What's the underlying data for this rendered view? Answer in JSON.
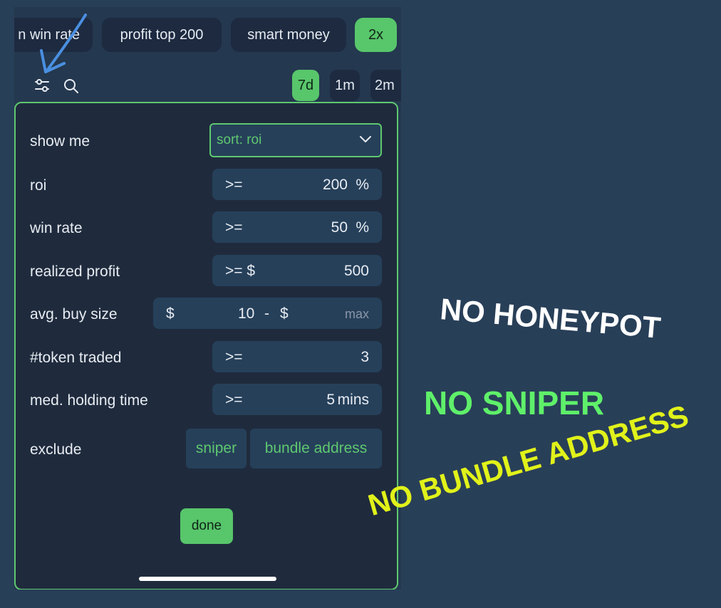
{
  "filter_pills": [
    {
      "label": "n win rate",
      "active": false
    },
    {
      "label": "profit top 200",
      "active": false
    },
    {
      "label": "smart money",
      "active": false
    },
    {
      "label": "2x",
      "active": true
    }
  ],
  "toolbar": {
    "filter_icon": "sliders-icon",
    "search_icon": "search-icon",
    "timeframes": [
      {
        "label": "7d",
        "active": true
      },
      {
        "label": "1m",
        "active": false
      },
      {
        "label": "2m",
        "active": false
      }
    ]
  },
  "filter_sheet": {
    "show_me": {
      "label": "show me",
      "value": "sort: roi"
    },
    "roi": {
      "label": "roi",
      "op": ">=",
      "value": "200",
      "unit": "%"
    },
    "win_rate": {
      "label": "win rate",
      "op": ">=",
      "value": "50",
      "unit": "%"
    },
    "realized_profit": {
      "label": "realized profit",
      "op": ">= $",
      "value": "500"
    },
    "avg_buy_size": {
      "label": "avg. buy size",
      "min_prefix": "$",
      "min": "10",
      "dash": "-",
      "max_prefix": "$",
      "max_placeholder": "max"
    },
    "token_traded": {
      "label": "#token traded",
      "op": ">=",
      "value": "3"
    },
    "holding_time": {
      "label": "med. holding time",
      "op": ">=",
      "value": "5",
      "unit": "mins"
    },
    "exclude": {
      "label": "exclude",
      "options": [
        "sniper",
        "bundle address"
      ]
    },
    "done_label": "done"
  },
  "annotations": {
    "line1": "NO HONEYPOT",
    "line2": "NO SNIPER",
    "line3": "NO BUNDLE ADDRESS",
    "colors": {
      "line1": "#ffffff",
      "line2": "#5ff06a",
      "line3": "#e1f21a",
      "arrow": "#4a8fe0"
    }
  },
  "colors": {
    "accent": "#58c66b",
    "panel": "#1f2b3d",
    "field": "#26405a"
  }
}
